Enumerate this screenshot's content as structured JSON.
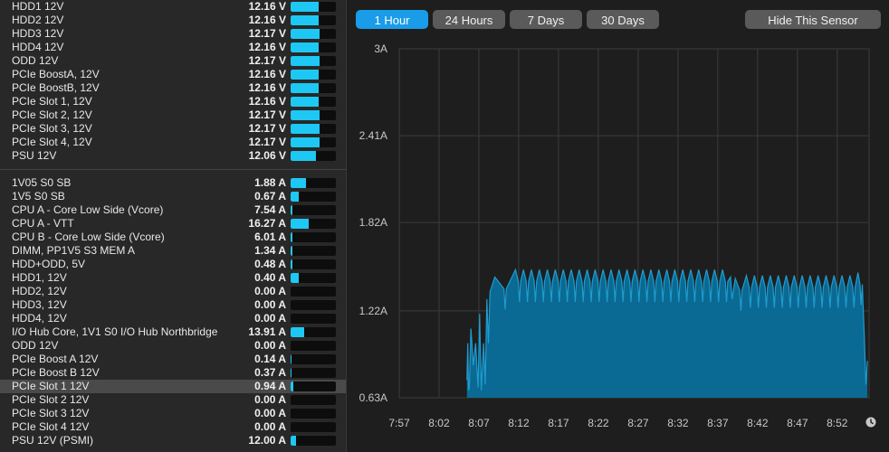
{
  "voltage_sensors": [
    {
      "name": "HDD1 12V",
      "value": "12.16 V",
      "fill": 0.62
    },
    {
      "name": "HDD2 12V",
      "value": "12.16 V",
      "fill": 0.62
    },
    {
      "name": "HDD3 12V",
      "value": "12.17 V",
      "fill": 0.63
    },
    {
      "name": "HDD4 12V",
      "value": "12.16 V",
      "fill": 0.62
    },
    {
      "name": "ODD 12V",
      "value": "12.17 V",
      "fill": 0.63
    },
    {
      "name": "PCIe BoostA, 12V",
      "value": "12.16 V",
      "fill": 0.62
    },
    {
      "name": "PCIe BoostB, 12V",
      "value": "12.16 V",
      "fill": 0.62
    },
    {
      "name": "PCIe Slot 1, 12V",
      "value": "12.16 V",
      "fill": 0.62
    },
    {
      "name": "PCIe Slot 2, 12V",
      "value": "12.17 V",
      "fill": 0.63
    },
    {
      "name": "PCIe Slot 3, 12V",
      "value": "12.17 V",
      "fill": 0.63
    },
    {
      "name": "PCIe Slot 4, 12V",
      "value": "12.17 V",
      "fill": 0.63
    },
    {
      "name": "PSU 12V",
      "value": "12.06 V",
      "fill": 0.55
    }
  ],
  "current_sensors": [
    {
      "name": "1V05 S0 SB",
      "value": "1.88 A",
      "fill": 0.34
    },
    {
      "name": "1V5 S0 SB",
      "value": "0.67 A",
      "fill": 0.18
    },
    {
      "name": "CPU A - Core Low Side (Vcore)",
      "value": "7.54 A",
      "fill": 0.04
    },
    {
      "name": "CPU A - VTT",
      "value": "16.27 A",
      "fill": 0.4
    },
    {
      "name": "CPU B - Core Low Side (Vcore)",
      "value": "6.01 A",
      "fill": 0.04
    },
    {
      "name": "DIMM, PP1V5 S3 MEM A",
      "value": "1.34 A",
      "fill": 0.03
    },
    {
      "name": "HDD+ODD, 5V",
      "value": "0.48 A",
      "fill": 0.03
    },
    {
      "name": "HDD1, 12V",
      "value": "0.40 A",
      "fill": 0.18
    },
    {
      "name": "HDD2, 12V",
      "value": "0.00 A",
      "fill": 0
    },
    {
      "name": "HDD3, 12V",
      "value": "0.00 A",
      "fill": 0
    },
    {
      "name": "HDD4, 12V",
      "value": "0.00 A",
      "fill": 0
    },
    {
      "name": "I/O Hub Core, 1V1 S0 I/O Hub Northbridge",
      "value": "13.91 A",
      "fill": 0.3
    },
    {
      "name": "ODD 12V",
      "value": "0.00 A",
      "fill": 0
    },
    {
      "name": "PCIe Boost A 12V",
      "value": "0.14 A",
      "fill": 0.02
    },
    {
      "name": "PCIe Boost B 12V",
      "value": "0.37 A",
      "fill": 0.02
    },
    {
      "name": "PCIe Slot 1 12V",
      "value": "0.94 A",
      "fill": 0.05,
      "selected": true
    },
    {
      "name": "PCIe Slot 2 12V",
      "value": "0.00 A",
      "fill": 0
    },
    {
      "name": "PCIe Slot 3 12V",
      "value": "0.00 A",
      "fill": 0
    },
    {
      "name": "PCIe Slot 4 12V",
      "value": "0.00 A",
      "fill": 0
    },
    {
      "name": "PSU 12V (PSMI)",
      "value": "12.00 A",
      "fill": 0.12
    }
  ],
  "toolbar": {
    "ranges": [
      {
        "label": "1 Hour",
        "active": true
      },
      {
        "label": "24 Hours",
        "active": false
      },
      {
        "label": "7 Days",
        "active": false
      },
      {
        "label": "30 Days",
        "active": false
      }
    ],
    "hide_label": "Hide This Sensor"
  },
  "colors": {
    "accent": "#1a9ce8",
    "bar_fill": "#1ec8f4",
    "area": "#0a6a94",
    "line": "#1e9cd0"
  },
  "chart_data": {
    "type": "area",
    "y_ticks": [
      "3A",
      "2.41A",
      "1.82A",
      "1.22A",
      "0.63A"
    ],
    "y_tick_values": [
      3,
      2.41,
      1.82,
      1.22,
      0.63
    ],
    "ylim": [
      0.63,
      3
    ],
    "x_ticks": [
      "7:57",
      "8:02",
      "8:07",
      "8:12",
      "8:17",
      "8:22",
      "8:27",
      "8:32",
      "8:37",
      "8:42",
      "8:47",
      "8:52"
    ],
    "x_tick_minutes": [
      0,
      5,
      10,
      15,
      20,
      25,
      30,
      35,
      40,
      45,
      50,
      55
    ],
    "xlim": [
      0,
      59
    ],
    "grid": true,
    "clock_icon": "clock-icon",
    "series": [
      {
        "x": [
          8.5,
          8.6,
          8.7,
          8.8,
          9.0,
          9.3,
          9.6,
          9.9,
          10.1,
          10.3,
          10.6,
          10.8,
          11.0,
          11.2,
          11.4,
          12.0,
          14.6,
          15.6,
          16.6,
          17.6,
          18.6,
          19.6,
          20.6,
          21.6,
          22.6,
          23.6,
          24.6,
          25.6,
          26.6,
          27.6,
          28.6,
          29.6,
          30.6,
          31.6,
          32.6,
          33.6,
          34.6,
          35.6,
          36.6,
          37.6,
          38.6,
          39.6,
          40.6,
          41.6,
          41.8,
          42.2,
          43.6,
          44.6,
          45.6,
          46.6,
          47.6,
          48.6,
          49.6,
          50.6,
          51.6,
          52.6,
          53.6,
          54.6,
          55.6,
          56.6,
          57.6,
          58.4,
          58.6,
          58.8
        ],
        "y": [
          0.75,
          1.0,
          0.68,
          0.7,
          1.1,
          0.85,
          1.0,
          0.7,
          1.2,
          0.68,
          1.0,
          0.72,
          1.3,
          1.0,
          1.35,
          1.45,
          1.5,
          1.5,
          1.5,
          1.5,
          1.5,
          1.5,
          1.5,
          1.5,
          1.5,
          1.5,
          1.5,
          1.5,
          1.5,
          1.5,
          1.5,
          1.5,
          1.5,
          1.5,
          1.5,
          1.5,
          1.5,
          1.5,
          1.5,
          1.5,
          1.5,
          1.5,
          1.5,
          1.45,
          1.3,
          1.44,
          1.46,
          1.46,
          1.46,
          1.46,
          1.46,
          1.46,
          1.46,
          1.46,
          1.46,
          1.46,
          1.46,
          1.46,
          1.46,
          1.46,
          1.48,
          1.05,
          0.72,
          0.88
        ]
      }
    ]
  }
}
